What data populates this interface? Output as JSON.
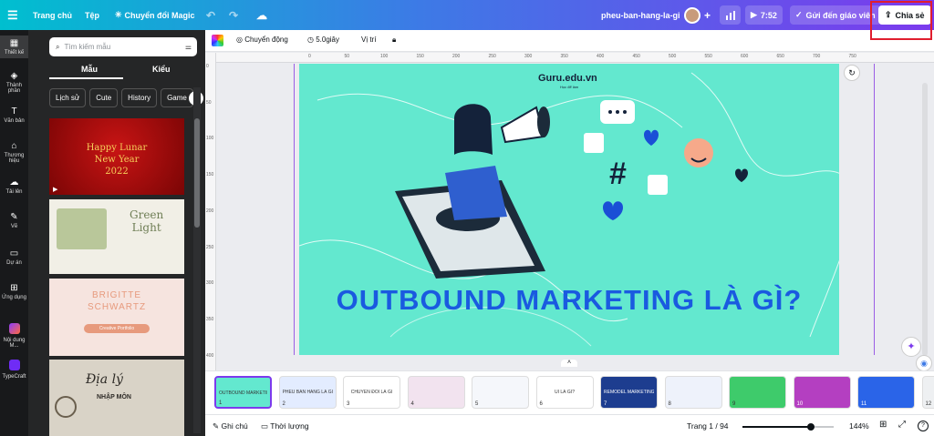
{
  "topbar": {
    "menu_icon": "hamburger-icon",
    "home": "Trang chủ",
    "file": "Tệp",
    "magic": "Chuyển đổi Magic",
    "doc_title": "pheu-ban-hang-la-gi",
    "play_time": "7:52",
    "send_teacher": "Gửi đến giáo viên",
    "share": "Chia sẻ",
    "highlight_color": "#e01e2e"
  },
  "rail": [
    {
      "label": "Thiết kế",
      "icon": "layout-icon"
    },
    {
      "label": "Thành phần",
      "icon": "shapes-icon"
    },
    {
      "label": "Văn bản",
      "icon": "text-icon"
    },
    {
      "label": "Thương hiệu",
      "icon": "brand-icon"
    },
    {
      "label": "Tải lên",
      "icon": "upload-icon"
    },
    {
      "label": "Vẽ",
      "icon": "draw-icon"
    },
    {
      "label": "Dự án",
      "icon": "folder-icon"
    },
    {
      "label": "Ứng dụng",
      "icon": "apps-icon"
    },
    {
      "label": "Nội dung M...",
      "icon": "magic-media-icon"
    },
    {
      "label": "TypeCraft",
      "icon": "typecraft-icon"
    }
  ],
  "panel": {
    "search_placeholder": "Tìm kiếm mẫu",
    "tab_templates": "Mẫu",
    "tab_styles": "Kiểu",
    "chips": [
      "Lịch sử",
      "Cute",
      "History",
      "Game"
    ],
    "thumbs": [
      {
        "line1": "Happy Lunar",
        "line2": "New Year",
        "line3": "2022"
      },
      {
        "line1": "Green",
        "line2": "Light"
      },
      {
        "line1": "BRIGITTE",
        "line2": "SCHWARTZ",
        "line3": "Creative Portfolio"
      },
      {
        "line1": "Địa lý",
        "line2": "NHẬP MÔN"
      }
    ]
  },
  "context": {
    "animation": "Chuyển động",
    "duration": "5.0giây",
    "position": "Vị trí"
  },
  "ruler": {
    "h": [
      "0",
      "50",
      "100",
      "150",
      "200",
      "250",
      "300",
      "350",
      "400",
      "450",
      "500",
      "550",
      "600",
      "650",
      "700",
      "750"
    ],
    "v": [
      "0",
      "50",
      "100",
      "150",
      "200",
      "250",
      "300",
      "350",
      "400"
    ]
  },
  "slide": {
    "logo": "Guru.edu.vn",
    "logo_sub": "Học để làm",
    "heading": "OUTBOUND MARKETING LÀ GÌ?",
    "bg": "#63e8cf",
    "heading_color": "#1a5ae0"
  },
  "pages": [
    {
      "num": "1",
      "label": "OUTBOUND MARKETING LÀ GÌ?"
    },
    {
      "num": "2",
      "label": "PHỄU BÁN HÀNG LÀ GÌ"
    },
    {
      "num": "3",
      "label": "CHUYỂN ĐỔI LÀ GÌ"
    },
    {
      "num": "4",
      "label": ""
    },
    {
      "num": "5",
      "label": ""
    },
    {
      "num": "6",
      "label": "UI LÀ GÌ?"
    },
    {
      "num": "7",
      "label": "REMODEL MARKETING LÀ GÌ"
    },
    {
      "num": "8",
      "label": ""
    },
    {
      "num": "9",
      "label": ""
    },
    {
      "num": "10",
      "label": ""
    },
    {
      "num": "11",
      "label": ""
    },
    {
      "num": "12",
      "label": ""
    }
  ],
  "bottom": {
    "notes": "Ghi chú",
    "duration": "Thời lượng",
    "page": "Trang 1 / 94",
    "zoom": "144%",
    "zoom_level": 0.75
  }
}
